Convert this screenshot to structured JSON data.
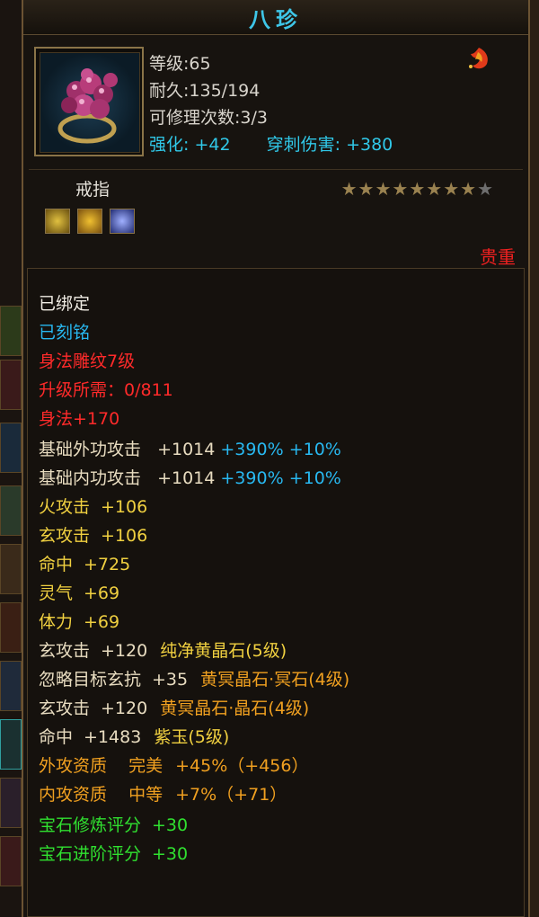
{
  "item": {
    "name": "八珍",
    "icon": "ring-icon",
    "level": "等级:65",
    "durability": "耐久:135/194",
    "repairs": "可修理次数:3/3",
    "enhance_label": "强化:",
    "enhance_value": "+42",
    "pierce_label": "穿刺伤害:",
    "pierce_value": "+380",
    "type": "戒指",
    "stars_total": 9,
    "stars_filled": 8,
    "rarity": "贵重"
  },
  "gem_slots": [
    {
      "icon": "yellow-gem-icon",
      "color": "#b89020"
    },
    {
      "icon": "gold-gem-icon",
      "color": "#d8a020"
    },
    {
      "icon": "blue-gem-icon",
      "color": "#5060c8"
    }
  ],
  "attributes": {
    "bound": "已绑定",
    "engraved": "已刻铭",
    "carving": "身法雕纹7级",
    "upgrade_need": "升级所需：0/811",
    "agility": "身法+170",
    "base_ext": {
      "label": "基础外功攻击",
      "v1": "+1014",
      "v2": "+390%",
      "v3": "+10%"
    },
    "base_int": {
      "label": "基础内功攻击",
      "v1": "+1014",
      "v2": "+390%",
      "v3": "+10%"
    },
    "fire": {
      "label": "火攻击",
      "value": "+106"
    },
    "xuan": {
      "label": "玄攻击",
      "value": "+106"
    },
    "hit": {
      "label": "命中",
      "value": "+725"
    },
    "spirit": {
      "label": "灵气",
      "value": "+69"
    },
    "stamina": {
      "label": "体力",
      "value": "+69"
    },
    "gem1": {
      "label": "玄攻击",
      "value": "+120",
      "gem": "纯净黄晶石(5级)"
    },
    "gem2": {
      "label": "忽略目标玄抗",
      "value": "+35",
      "gem": "黄冥晶石·冥石(4级)"
    },
    "gem3": {
      "label": "玄攻击",
      "value": "+120",
      "gem": "黄冥晶石·晶石(4级)"
    },
    "gem4": {
      "label": "命中",
      "value": "+1483",
      "gem": "紫玉(5级)"
    },
    "ext_quality": {
      "label": "外攻资质",
      "grade": "完美",
      "value": "+45%（+456）"
    },
    "int_quality": {
      "label": "内攻资质",
      "grade": "中等",
      "value": "+7%（+71）"
    },
    "gem_refine": {
      "label": "宝石修炼评分",
      "value": "+30"
    },
    "gem_advance": {
      "label": "宝石进阶评分",
      "value": "+30"
    }
  }
}
